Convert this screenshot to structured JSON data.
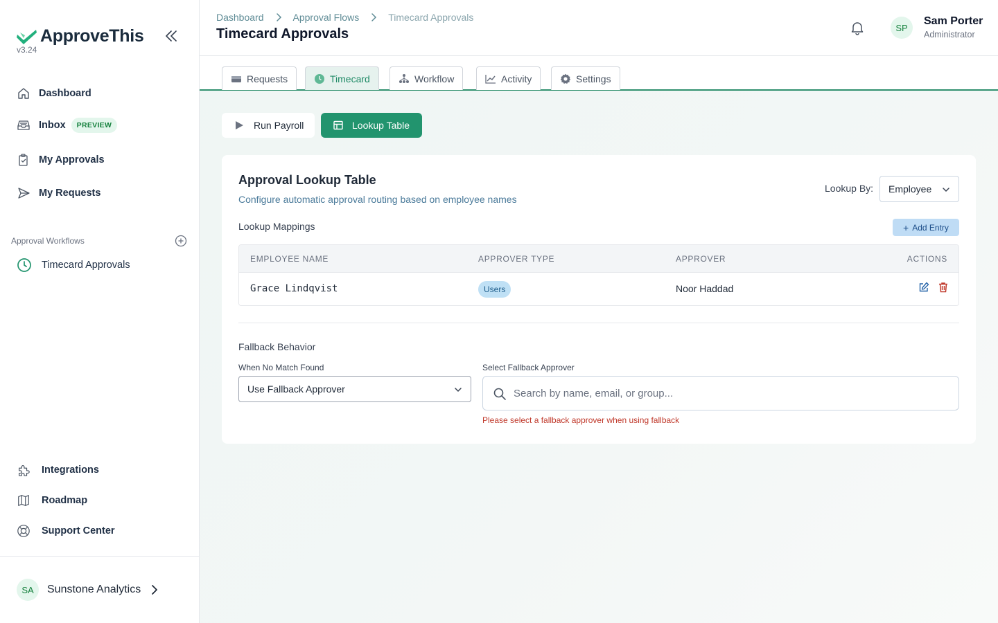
{
  "app": {
    "name": "ApproveThis",
    "version": "v3.24"
  },
  "sidebar": {
    "nav": [
      {
        "label": "Dashboard"
      },
      {
        "label": "Inbox",
        "badge": "PREVIEW"
      },
      {
        "label": "My Approvals"
      },
      {
        "label": "My Requests"
      }
    ],
    "workflows_title": "Approval Workflows",
    "workflows": [
      {
        "label": "Timecard Approvals"
      }
    ],
    "bottom": [
      {
        "label": "Integrations"
      },
      {
        "label": "Roadmap"
      },
      {
        "label": "Support Center"
      }
    ],
    "org": {
      "initials": "SA",
      "name": "Sunstone Analytics"
    }
  },
  "header": {
    "breadcrumbs": [
      "Dashboard",
      "Approval Flows",
      "Timecard Approvals"
    ],
    "title": "Timecard Approvals",
    "user": {
      "initials": "SP",
      "name": "Sam Porter",
      "role": "Administrator"
    }
  },
  "tabs": [
    {
      "label": "Requests"
    },
    {
      "label": "Timecard",
      "active": true
    },
    {
      "label": "Workflow"
    },
    {
      "label": "Activity"
    },
    {
      "label": "Settings"
    }
  ],
  "actions": {
    "run_payroll": "Run Payroll",
    "lookup_table": "Lookup Table"
  },
  "card": {
    "title": "Approval Lookup Table",
    "subtitle": "Configure automatic approval routing based on employee names",
    "lookup_by_label": "Lookup By:",
    "lookup_by_value": "Employee",
    "mappings_label": "Lookup Mappings",
    "add_entry": "Add Entry",
    "columns": [
      "EMPLOYEE NAME",
      "APPROVER TYPE",
      "APPROVER",
      "ACTIONS"
    ],
    "rows": [
      {
        "employee": "Grace Lindqvist",
        "type": "Users",
        "approver": "Noor Haddad"
      }
    ],
    "fallback": {
      "title": "Fallback Behavior",
      "no_match_label": "When No Match Found",
      "no_match_value": "Use Fallback Approver",
      "select_label": "Select Fallback Approver",
      "search_placeholder": "Search by name, email, or group...",
      "error": "Please select a fallback approver when using fallback"
    }
  },
  "colors": {
    "brand": "#22946e",
    "accent_light": "#e3f6ec",
    "error": "#c0392b"
  }
}
